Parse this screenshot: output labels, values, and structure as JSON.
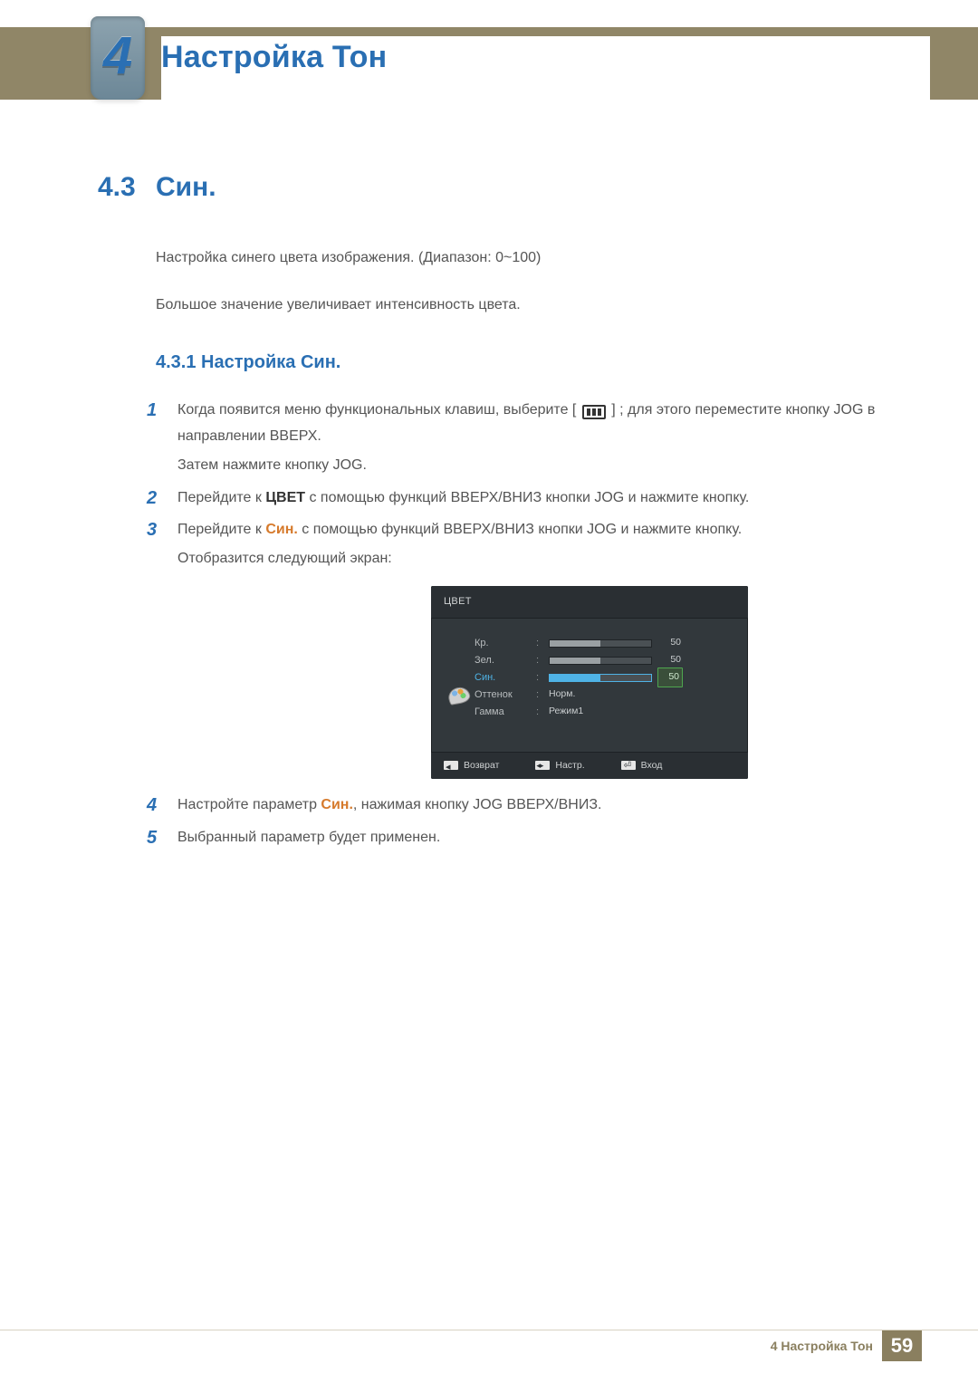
{
  "header": {
    "chapter_number": "4",
    "chapter_title": "Настройка Тон"
  },
  "section": {
    "number": "4.3",
    "title": "Син."
  },
  "intro": {
    "p1": "Настройка синего цвета изображения. (Диапазон: 0~100)",
    "p2": "Большое значение увеличивает интенсивность цвета."
  },
  "subsection": {
    "number": "4.3.1",
    "title": "Настройка Син."
  },
  "steps": {
    "s1": {
      "num": "1",
      "frag_a": "Когда появится меню функциональных клавиш, выберите [",
      "frag_b": "] ; для этого переместите кнопку JOG в направлении ВВЕРХ.",
      "line2": "Затем нажмите кнопку JOG."
    },
    "s2": {
      "num": "2",
      "pre": "Перейдите к ",
      "bold": "ЦВЕТ",
      "post": " с помощью функций ВВЕРХ/ВНИЗ кнопки JOG и нажмите кнопку."
    },
    "s3": {
      "num": "3",
      "pre": "Перейдите к ",
      "bold": "Син.",
      "post": " с помощью функций ВВЕРХ/ВНИЗ кнопки JOG и нажмите кнопку.",
      "line2": "Отобразится следующий экран:"
    },
    "s4": {
      "num": "4",
      "pre": "Настройте параметр ",
      "bold": "Син.",
      "post": ", нажимая кнопку JOG ВВЕРХ/ВНИЗ."
    },
    "s5": {
      "num": "5",
      "text": "Выбранный параметр будет применен."
    }
  },
  "osd": {
    "title": "ЦВЕТ",
    "rows": {
      "r": {
        "label": "Кр.",
        "value": "50",
        "fill_pct": 50,
        "selected": false
      },
      "g": {
        "label": "Зел.",
        "value": "50",
        "fill_pct": 50,
        "selected": false
      },
      "b": {
        "label": "Син.",
        "value": "50",
        "fill_pct": 50,
        "selected": true
      },
      "tone": {
        "label": "Оттенок",
        "text_value": "Норм."
      },
      "gamma": {
        "label": "Гамма",
        "text_value": "Режим1"
      }
    },
    "footer": {
      "back": "Возврат",
      "adjust": "Настр.",
      "enter": "Вход"
    }
  },
  "footer": {
    "label": "4 Настройка Тон",
    "page": "59"
  }
}
